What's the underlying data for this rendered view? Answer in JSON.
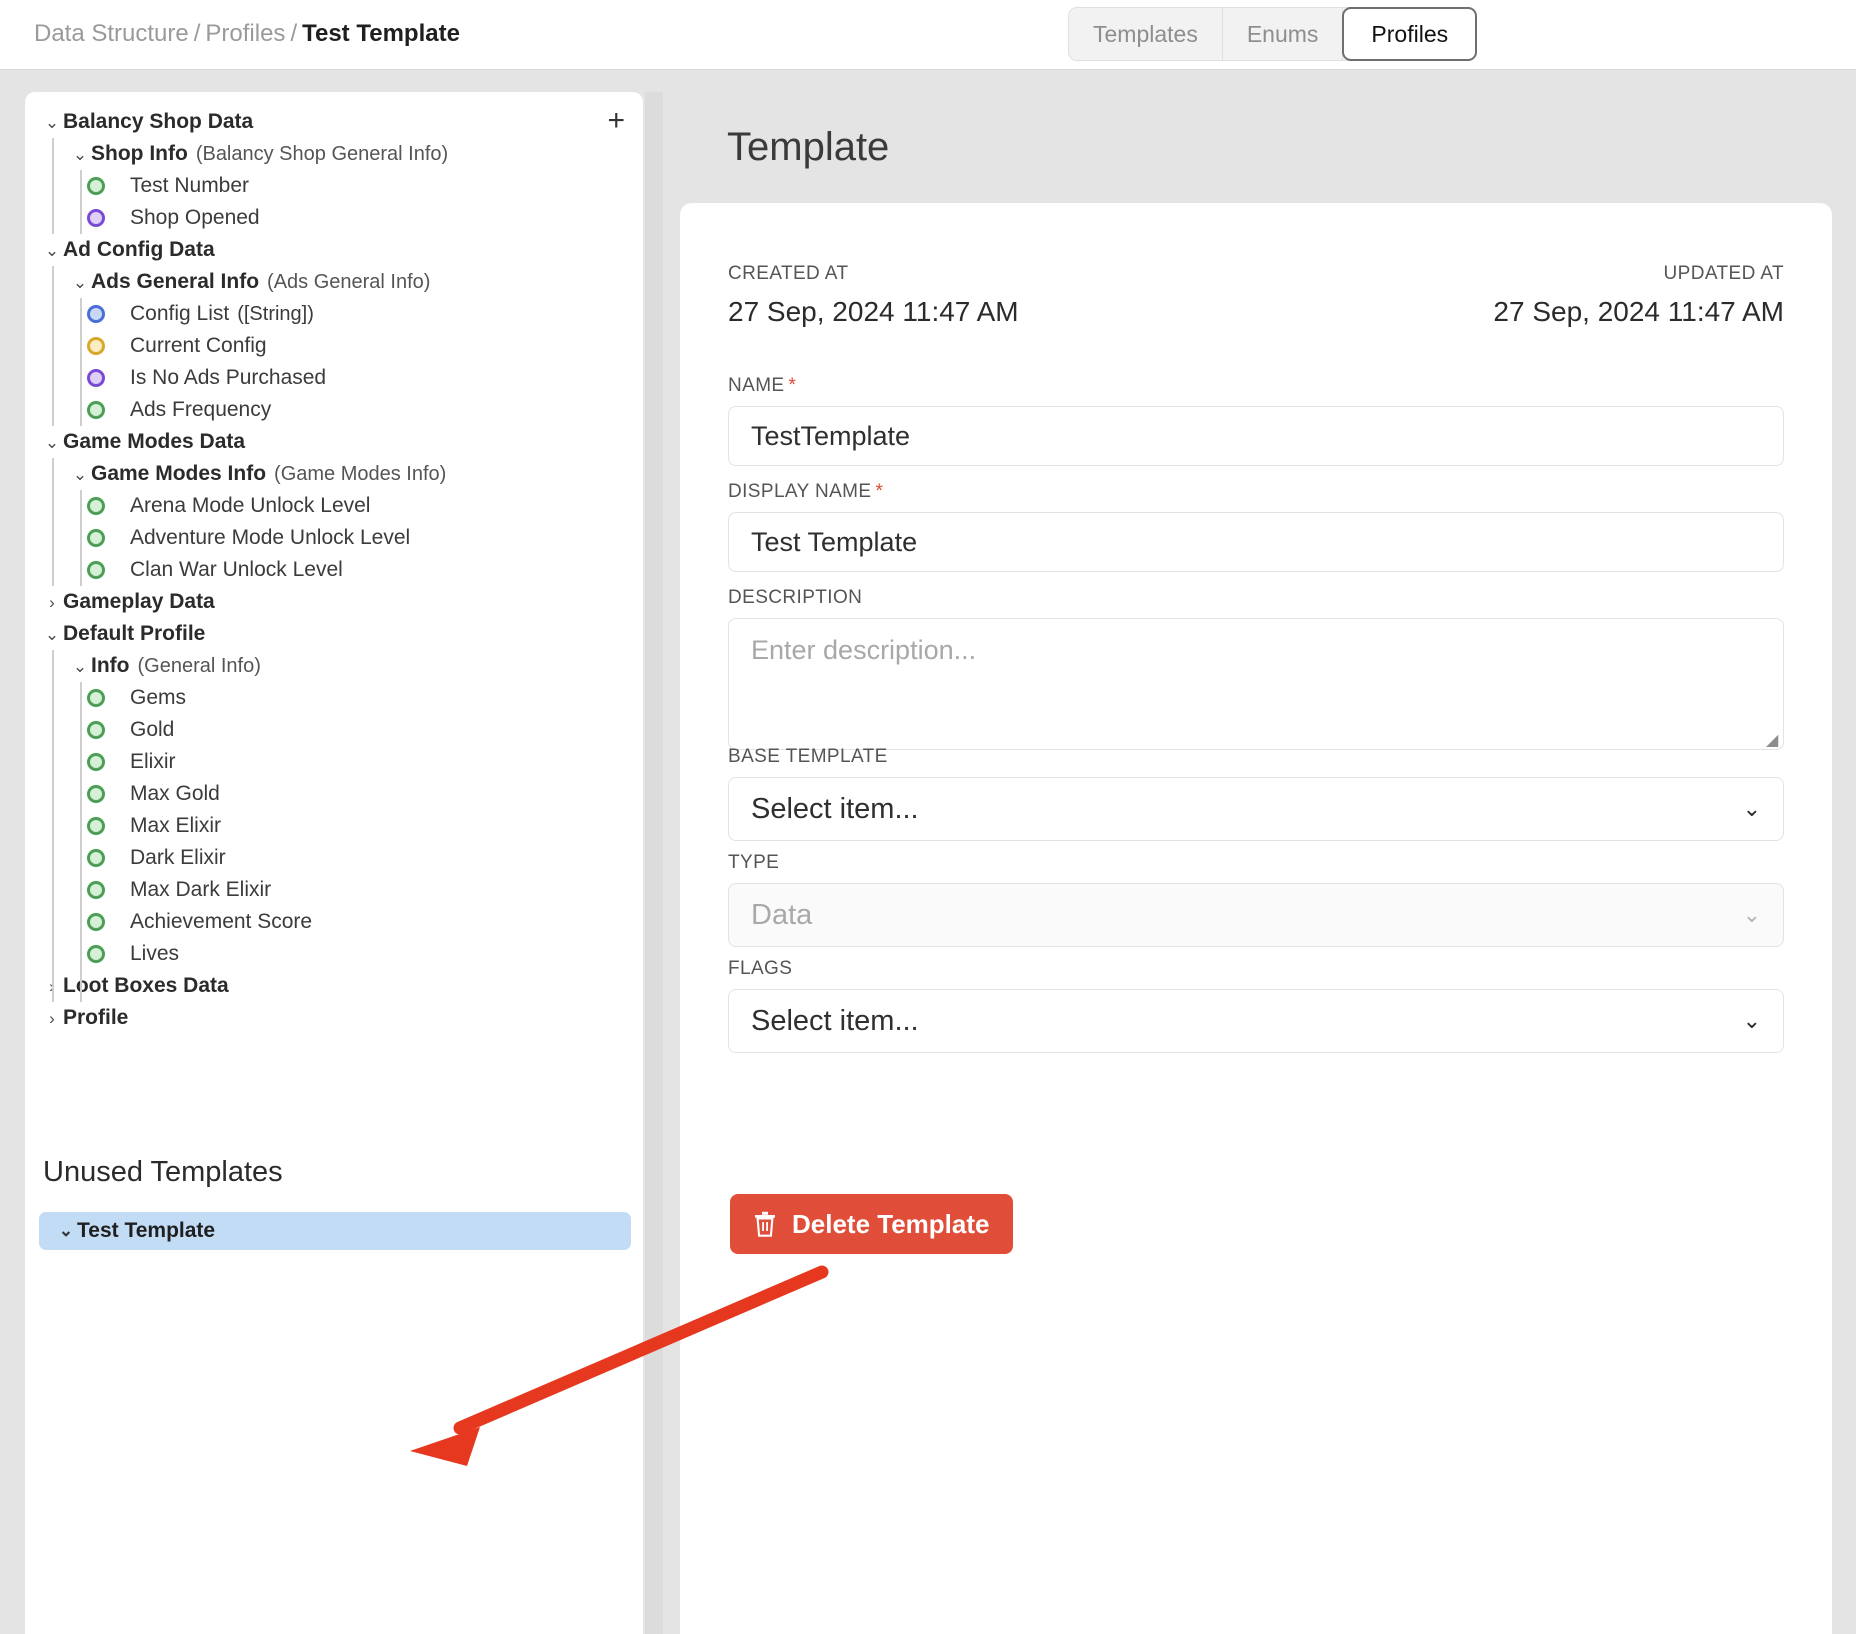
{
  "breadcrumb": {
    "items": [
      "Data Structure",
      "Profiles",
      "Test Template"
    ],
    "separator": "/"
  },
  "tabs": [
    {
      "label": "Templates",
      "active": false
    },
    {
      "label": "Enums",
      "active": false
    },
    {
      "label": "Profiles",
      "active": true
    }
  ],
  "sidebar": {
    "add_button": "+",
    "tree": [
      {
        "label": "Balancy Shop Data",
        "level": 0,
        "kind": "group",
        "chevron": "expanded"
      },
      {
        "label": "Shop Info",
        "type_hint": "(Balancy Shop General Info)",
        "level": 1,
        "kind": "group",
        "chevron": "expanded"
      },
      {
        "label": "Test Number",
        "level": 2,
        "kind": "leaf",
        "bullet": "green"
      },
      {
        "label": "Shop Opened",
        "level": 2,
        "kind": "leaf",
        "bullet": "purple"
      },
      {
        "label": "Ad Config Data",
        "level": 0,
        "kind": "group",
        "chevron": "expanded"
      },
      {
        "label": "Ads General Info",
        "type_hint": "(Ads General Info)",
        "level": 1,
        "kind": "group",
        "chevron": "expanded"
      },
      {
        "label": "Config List",
        "type_hint": "([String])",
        "level": 2,
        "kind": "leaf",
        "bullet": "blue"
      },
      {
        "label": "Current Config",
        "level": 2,
        "kind": "leaf",
        "bullet": "yellow"
      },
      {
        "label": "Is No Ads Purchased",
        "level": 2,
        "kind": "leaf",
        "bullet": "purple"
      },
      {
        "label": "Ads Frequency",
        "level": 2,
        "kind": "leaf",
        "bullet": "green"
      },
      {
        "label": "Game Modes Data",
        "level": 0,
        "kind": "group",
        "chevron": "expanded"
      },
      {
        "label": "Game Modes Info",
        "type_hint": "(Game Modes Info)",
        "level": 1,
        "kind": "group",
        "chevron": "expanded"
      },
      {
        "label": "Arena Mode Unlock Level",
        "level": 2,
        "kind": "leaf",
        "bullet": "green"
      },
      {
        "label": "Adventure Mode Unlock Level",
        "level": 2,
        "kind": "leaf",
        "bullet": "green"
      },
      {
        "label": "Clan War Unlock Level",
        "level": 2,
        "kind": "leaf",
        "bullet": "green"
      },
      {
        "label": "Gameplay Data",
        "level": 0,
        "kind": "group",
        "chevron": "collapsed"
      },
      {
        "label": "Default Profile",
        "level": 0,
        "kind": "group",
        "chevron": "expanded"
      },
      {
        "label": "Info",
        "type_hint": "(General Info)",
        "level": 1,
        "kind": "group",
        "chevron": "expanded"
      },
      {
        "label": "Gems",
        "level": 2,
        "kind": "leaf",
        "bullet": "green"
      },
      {
        "label": "Gold",
        "level": 2,
        "kind": "leaf",
        "bullet": "green"
      },
      {
        "label": "Elixir",
        "level": 2,
        "kind": "leaf",
        "bullet": "green"
      },
      {
        "label": "Max Gold",
        "level": 2,
        "kind": "leaf",
        "bullet": "green"
      },
      {
        "label": "Max Elixir",
        "level": 2,
        "kind": "leaf",
        "bullet": "green"
      },
      {
        "label": "Dark Elixir",
        "level": 2,
        "kind": "leaf",
        "bullet": "green"
      },
      {
        "label": "Max Dark Elixir",
        "level": 2,
        "kind": "leaf",
        "bullet": "green"
      },
      {
        "label": "Achievement Score",
        "level": 2,
        "kind": "leaf",
        "bullet": "green"
      },
      {
        "label": "Lives",
        "level": 2,
        "kind": "leaf",
        "bullet": "green"
      },
      {
        "label": "Loot Boxes Data",
        "level": 0,
        "kind": "group",
        "chevron": "collapsed"
      },
      {
        "label": "Profile",
        "level": 0,
        "kind": "group",
        "chevron": "collapsed"
      }
    ],
    "unused": {
      "title": "Unused Templates",
      "items": [
        {
          "label": "Test Template",
          "chevron": "expanded",
          "selected": true
        }
      ]
    }
  },
  "detail": {
    "title": "Template",
    "created_at_label": "CREATED AT",
    "created_at_value": "27 Sep, 2024 11:47 AM",
    "updated_at_label": "UPDATED AT",
    "updated_at_value": "27 Sep, 2024 11:47 AM",
    "name_label": "NAME",
    "name_value": "TestTemplate",
    "display_name_label": "DISPLAY NAME",
    "display_name_value": "Test Template",
    "description_label": "DESCRIPTION",
    "description_placeholder": "Enter description...",
    "base_template_label": "BASE TEMPLATE",
    "base_template_value": "Select item...",
    "type_label": "TYPE",
    "type_value": "Data",
    "flags_label": "FLAGS",
    "flags_value": "Select item...",
    "delete_button": "Delete Template",
    "required_marker": "*"
  },
  "colors": {
    "accent_delete": "#e04e39",
    "annotation_arrow": "#e5381f",
    "selection": "#c2dcf5",
    "page_background": "#e4e4e4"
  },
  "annotation": {
    "type": "arrow",
    "points_to": "Test Template"
  }
}
